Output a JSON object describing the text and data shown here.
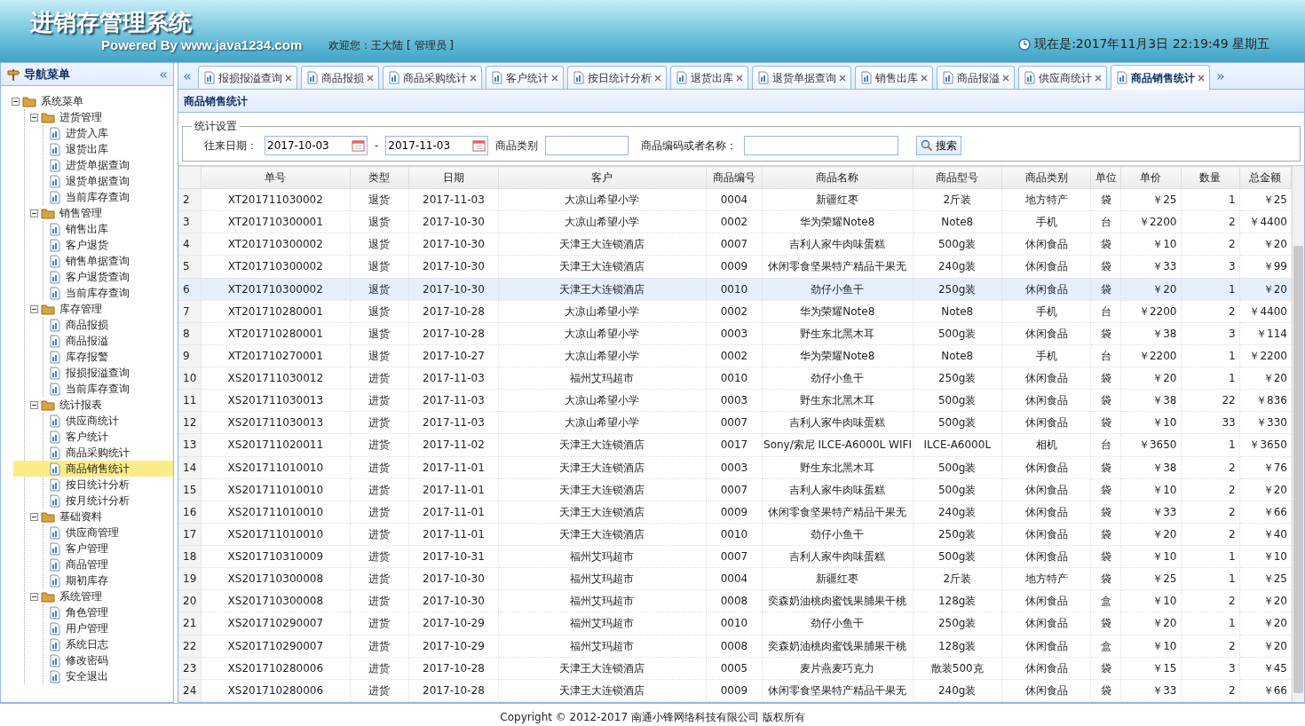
{
  "header": {
    "title": "进销存管理系统",
    "subtitle": "Powered By www.java1234.com",
    "welcome": "欢迎您：王大陆 [ 管理员 ]",
    "clock": "现在是:2017年11月3日 22:19:49 星期五"
  },
  "sidebar": {
    "title": "导航菜单",
    "collapse": "«",
    "tree": [
      {
        "label": "系统菜单",
        "expanded": true,
        "children": [
          {
            "label": "进货管理",
            "expanded": true,
            "children": [
              {
                "label": "进货入库",
                "selected": false
              },
              {
                "label": "退货出库",
                "selected": false
              },
              {
                "label": "进货单据查询",
                "selected": false
              },
              {
                "label": "退货单据查询",
                "selected": false
              },
              {
                "label": "当前库存查询",
                "selected": false
              }
            ]
          },
          {
            "label": "销售管理",
            "expanded": true,
            "children": [
              {
                "label": "销售出库",
                "selected": false
              },
              {
                "label": "客户退货",
                "selected": false
              },
              {
                "label": "销售单据查询",
                "selected": false
              },
              {
                "label": "客户退货查询",
                "selected": false
              },
              {
                "label": "当前库存查询",
                "selected": false
              }
            ]
          },
          {
            "label": "库存管理",
            "expanded": true,
            "children": [
              {
                "label": "商品报损",
                "selected": false
              },
              {
                "label": "商品报溢",
                "selected": false
              },
              {
                "label": "库存报警",
                "selected": false
              },
              {
                "label": "报损报溢查询",
                "selected": false
              },
              {
                "label": "当前库存查询",
                "selected": false
              }
            ]
          },
          {
            "label": "统计报表",
            "expanded": true,
            "children": [
              {
                "label": "供应商统计",
                "selected": false
              },
              {
                "label": "客户统计",
                "selected": false
              },
              {
                "label": "商品采购统计",
                "selected": false
              },
              {
                "label": "商品销售统计",
                "selected": true
              },
              {
                "label": "按日统计分析",
                "selected": false
              },
              {
                "label": "按月统计分析",
                "selected": false
              }
            ]
          },
          {
            "label": "基础资料",
            "expanded": true,
            "children": [
              {
                "label": "供应商管理",
                "selected": false
              },
              {
                "label": "客户管理",
                "selected": false
              },
              {
                "label": "商品管理",
                "selected": false
              },
              {
                "label": "期初库存",
                "selected": false
              }
            ]
          },
          {
            "label": "系统管理",
            "expanded": true,
            "children": [
              {
                "label": "角色管理",
                "selected": false
              },
              {
                "label": "用户管理",
                "selected": false
              },
              {
                "label": "系统日志",
                "selected": false
              },
              {
                "label": "修改密码",
                "selected": false
              },
              {
                "label": "安全退出",
                "selected": false
              }
            ]
          }
        ]
      }
    ]
  },
  "tabs": {
    "prev": "«",
    "next": "»",
    "items": [
      {
        "label": "报损报溢查询",
        "selected": false
      },
      {
        "label": "商品报损",
        "selected": false
      },
      {
        "label": "商品采购统计",
        "selected": false
      },
      {
        "label": "客户统计",
        "selected": false
      },
      {
        "label": "按日统计分析",
        "selected": false
      },
      {
        "label": "退货出库",
        "selected": false
      },
      {
        "label": "退货单据查询",
        "selected": false
      },
      {
        "label": "销售出库",
        "selected": false
      },
      {
        "label": "商品报溢",
        "selected": false
      },
      {
        "label": "供应商统计",
        "selected": false
      },
      {
        "label": "商品销售统计",
        "selected": true
      }
    ]
  },
  "panel": {
    "title": "商品销售统计",
    "legend": "统计设置",
    "date_label": "往来日期：",
    "date_from": "2017-10-03",
    "dash": "-",
    "date_to": "2017-11-03",
    "category_label": "商品类别",
    "keyword_label": "商品编码或者名称：",
    "search": "搜索"
  },
  "table": {
    "columns": [
      "",
      "单号",
      "类型",
      "日期",
      "客户",
      "商品编号",
      "商品名称",
      "商品型号",
      "商品类别",
      "单位",
      "单价",
      "数量",
      "总金额"
    ],
    "rows": [
      {
        "selected": false,
        "cells": [
          "2",
          "XT201711030002",
          "退货",
          "2017-11-03",
          "大凉山希望小学",
          "0004",
          "新疆红枣",
          "2斤装",
          "地方特产",
          "袋",
          "￥25",
          "1",
          "￥25"
        ]
      },
      {
        "selected": false,
        "cells": [
          "3",
          "XT201710300001",
          "退货",
          "2017-10-30",
          "大凉山希望小学",
          "0002",
          "华为荣耀Note8",
          "Note8",
          "手机",
          "台",
          "￥2200",
          "2",
          "￥4400"
        ]
      },
      {
        "selected": false,
        "cells": [
          "4",
          "XT201710300002",
          "退货",
          "2017-10-30",
          "天津王大连锁酒店",
          "0007",
          "吉利人家牛肉味蛋糕",
          "500g装",
          "休闲食品",
          "袋",
          "￥10",
          "2",
          "￥20"
        ]
      },
      {
        "selected": false,
        "cells": [
          "5",
          "XT201710300002",
          "退货",
          "2017-10-30",
          "天津王大连锁酒店",
          "0009",
          "休闲零食坚果特产精品干果无",
          "240g装",
          "休闲食品",
          "袋",
          "￥33",
          "3",
          "￥99"
        ]
      },
      {
        "selected": true,
        "cells": [
          "6",
          "XT201710300002",
          "退货",
          "2017-10-30",
          "天津王大连锁酒店",
          "0010",
          "劲仔小鱼干",
          "250g装",
          "休闲食品",
          "袋",
          "￥20",
          "1",
          "￥20"
        ]
      },
      {
        "selected": false,
        "cells": [
          "7",
          "XT201710280001",
          "退货",
          "2017-10-28",
          "大凉山希望小学",
          "0002",
          "华为荣耀Note8",
          "Note8",
          "手机",
          "台",
          "￥2200",
          "2",
          "￥4400"
        ]
      },
      {
        "selected": false,
        "cells": [
          "8",
          "XT201710280001",
          "退货",
          "2017-10-28",
          "大凉山希望小学",
          "0003",
          "野生东北黑木耳",
          "500g装",
          "休闲食品",
          "袋",
          "￥38",
          "3",
          "￥114"
        ]
      },
      {
        "selected": false,
        "cells": [
          "9",
          "XT201710270001",
          "退货",
          "2017-10-27",
          "大凉山希望小学",
          "0002",
          "华为荣耀Note8",
          "Note8",
          "手机",
          "台",
          "￥2200",
          "1",
          "￥2200"
        ]
      },
      {
        "selected": false,
        "cells": [
          "10",
          "XS201711030012",
          "进货",
          "2017-11-03",
          "福州艾玛超市",
          "0010",
          "劲仔小鱼干",
          "250g装",
          "休闲食品",
          "袋",
          "￥20",
          "1",
          "￥20"
        ]
      },
      {
        "selected": false,
        "cells": [
          "11",
          "XS201711030013",
          "进货",
          "2017-11-03",
          "大凉山希望小学",
          "0003",
          "野生东北黑木耳",
          "500g装",
          "休闲食品",
          "袋",
          "￥38",
          "22",
          "￥836"
        ]
      },
      {
        "selected": false,
        "cells": [
          "12",
          "XS201711030013",
          "进货",
          "2017-11-03",
          "大凉山希望小学",
          "0007",
          "吉利人家牛肉味蛋糕",
          "500g装",
          "休闲食品",
          "袋",
          "￥10",
          "33",
          "￥330"
        ]
      },
      {
        "selected": false,
        "cells": [
          "13",
          "XS201711020011",
          "进货",
          "2017-11-02",
          "天津王大连锁酒店",
          "0017",
          "Sony/索尼 ILCE-A6000L WIFI",
          "ILCE-A6000L",
          "相机",
          "台",
          "￥3650",
          "1",
          "￥3650"
        ]
      },
      {
        "selected": false,
        "cells": [
          "14",
          "XS201711010010",
          "进货",
          "2017-11-01",
          "天津王大连锁酒店",
          "0003",
          "野生东北黑木耳",
          "500g装",
          "休闲食品",
          "袋",
          "￥38",
          "2",
          "￥76"
        ]
      },
      {
        "selected": false,
        "cells": [
          "15",
          "XS201711010010",
          "进货",
          "2017-11-01",
          "天津王大连锁酒店",
          "0007",
          "吉利人家牛肉味蛋糕",
          "500g装",
          "休闲食品",
          "袋",
          "￥10",
          "2",
          "￥20"
        ]
      },
      {
        "selected": false,
        "cells": [
          "16",
          "XS201711010010",
          "进货",
          "2017-11-01",
          "天津王大连锁酒店",
          "0009",
          "休闲零食坚果特产精品干果无",
          "240g装",
          "休闲食品",
          "袋",
          "￥33",
          "2",
          "￥66"
        ]
      },
      {
        "selected": false,
        "cells": [
          "17",
          "XS201711010010",
          "进货",
          "2017-11-01",
          "天津王大连锁酒店",
          "0010",
          "劲仔小鱼干",
          "250g装",
          "休闲食品",
          "袋",
          "￥20",
          "2",
          "￥40"
        ]
      },
      {
        "selected": false,
        "cells": [
          "18",
          "XS201710310009",
          "进货",
          "2017-10-31",
          "福州艾玛超市",
          "0007",
          "吉利人家牛肉味蛋糕",
          "500g装",
          "休闲食品",
          "袋",
          "￥10",
          "1",
          "￥10"
        ]
      },
      {
        "selected": false,
        "cells": [
          "19",
          "XS201710300008",
          "进货",
          "2017-10-30",
          "福州艾玛超市",
          "0004",
          "新疆红枣",
          "2斤装",
          "地方特产",
          "袋",
          "￥25",
          "1",
          "￥25"
        ]
      },
      {
        "selected": false,
        "cells": [
          "20",
          "XS201710300008",
          "进货",
          "2017-10-30",
          "福州艾玛超市",
          "0008",
          "奕森奶油桃肉蜜饯果脯果干桃",
          "128g装",
          "休闲食品",
          "盒",
          "￥10",
          "2",
          "￥20"
        ]
      },
      {
        "selected": false,
        "cells": [
          "21",
          "XS201710290007",
          "进货",
          "2017-10-29",
          "福州艾玛超市",
          "0010",
          "劲仔小鱼干",
          "250g装",
          "休闲食品",
          "袋",
          "￥20",
          "1",
          "￥20"
        ]
      },
      {
        "selected": false,
        "cells": [
          "22",
          "XS201710290007",
          "进货",
          "2017-10-29",
          "福州艾玛超市",
          "0008",
          "奕森奶油桃肉蜜饯果脯果干桃",
          "128g装",
          "休闲食品",
          "盒",
          "￥10",
          "2",
          "￥20"
        ]
      },
      {
        "selected": false,
        "cells": [
          "23",
          "XS201710280006",
          "进货",
          "2017-10-28",
          "天津王大连锁酒店",
          "0005",
          "麦片燕麦巧克力",
          "散装500克",
          "休闲食品",
          "袋",
          "￥15",
          "3",
          "￥45"
        ]
      },
      {
        "selected": false,
        "cells": [
          "24",
          "XS201710280006",
          "进货",
          "2017-10-28",
          "天津王大连锁酒店",
          "0009",
          "休闲零食坚果特产精品干果无",
          "240g装",
          "休闲食品",
          "袋",
          "￥33",
          "2",
          "￥66"
        ]
      }
    ]
  },
  "footer": {
    "copyright": "Copyright © 2012-2017 南通小锋网络科技有限公司 版权所有"
  }
}
